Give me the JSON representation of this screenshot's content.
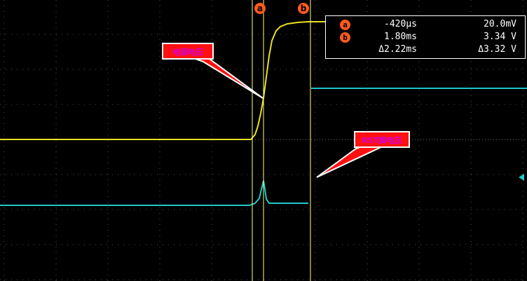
{
  "cursors": {
    "a": {
      "label": "a",
      "color": "#ff5a1e"
    },
    "b": {
      "label": "b",
      "color": "#ff5a1e"
    }
  },
  "readout": {
    "rows": [
      {
        "marker": "a",
        "time": "-420µs",
        "voltage": "20.0mV"
      },
      {
        "marker": "b",
        "time": "1.80ms",
        "voltage": "3.34 V"
      },
      {
        "marker": "",
        "time": "Δ2.22ms",
        "voltage": "Δ3.32 V"
      }
    ]
  },
  "annotations": {
    "power_voltage": "电源电压",
    "rst_voltage": "RST脚电压"
  },
  "colors": {
    "channel1": "#e8e020",
    "channel2": "#20c8c8",
    "cursor": "#ffff80",
    "callout_fill": "#ff1010",
    "callout_text": "#d400d4",
    "grid": "#606060"
  },
  "icons": {
    "channel2_level": "triangle-left-icon"
  }
}
